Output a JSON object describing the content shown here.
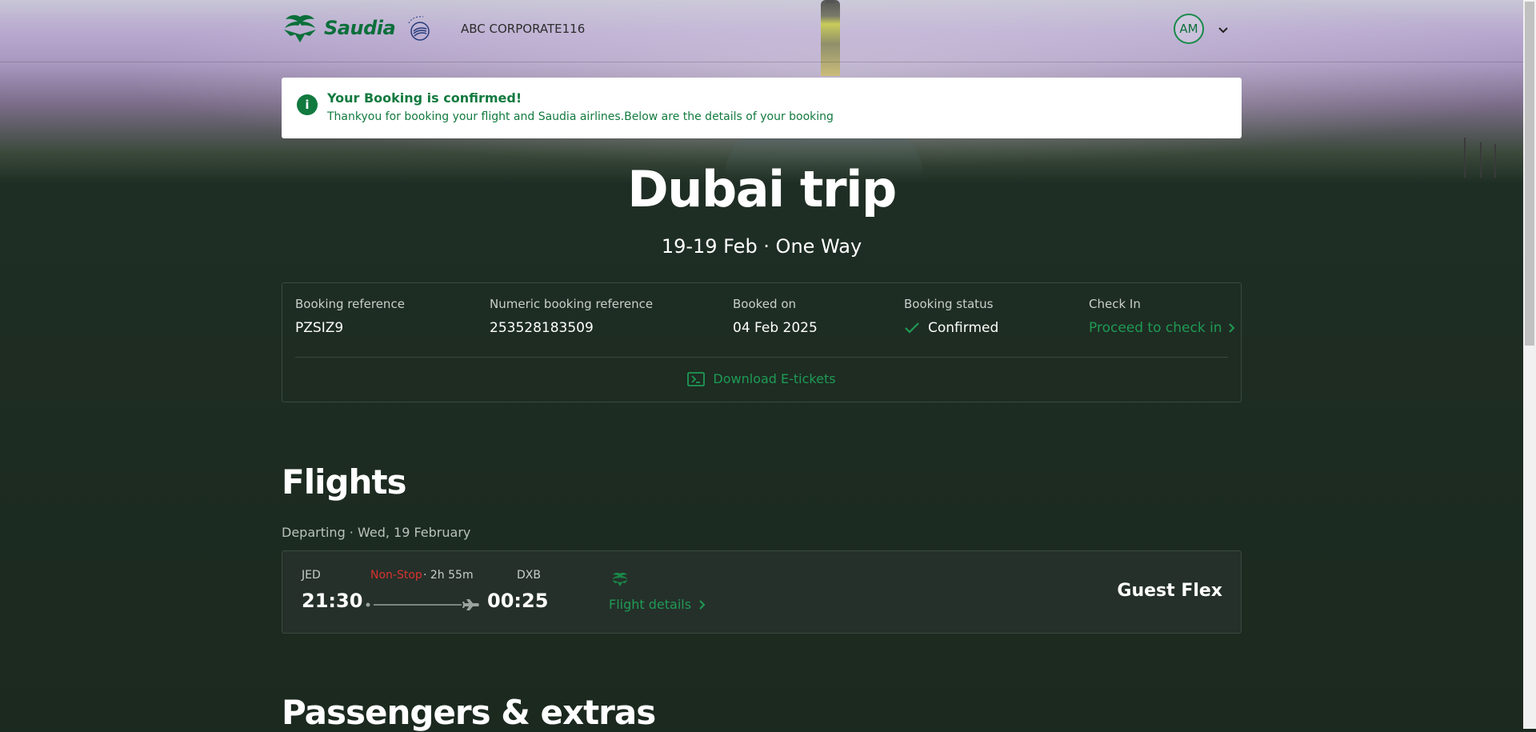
{
  "header": {
    "brand": "Saudia",
    "corporate": "ABC CORPORATE116",
    "avatar_initials": "AM"
  },
  "banner": {
    "title": "Your Booking is confirmed!",
    "message": "Thankyou for booking your flight and Saudia airlines.Below are the details of your booking"
  },
  "trip": {
    "title": "Dubai trip",
    "subtitle": "19-19 Feb · One Way"
  },
  "booking": {
    "reference_label": "Booking reference",
    "reference": "PZSIZ9",
    "numeric_label": "Numeric booking reference",
    "numeric": "253528183509",
    "booked_on_label": "Booked on",
    "booked_on": "04 Feb 2025",
    "status_label": "Booking status",
    "status": "Confirmed",
    "checkin_label": "Check In",
    "checkin_link": "Proceed to check in",
    "download": "Download E-tickets"
  },
  "flights": {
    "heading": "Flights",
    "departing": "Departing · Wed, 19 February",
    "from_code": "JED",
    "from_time": "21:30",
    "to_code": "DXB",
    "to_time": "00:25",
    "stops": "Non-Stop",
    "duration": "· 2h 55m",
    "details_link": "Flight details",
    "fare": "Guest Flex"
  },
  "passengers": {
    "heading": "Passengers & extras"
  },
  "colors": {
    "brand_green": "#0b6f3a",
    "link_green": "#1f9a55",
    "nonstop_red": "#d9322e",
    "page_bg": "#1b2a21"
  }
}
